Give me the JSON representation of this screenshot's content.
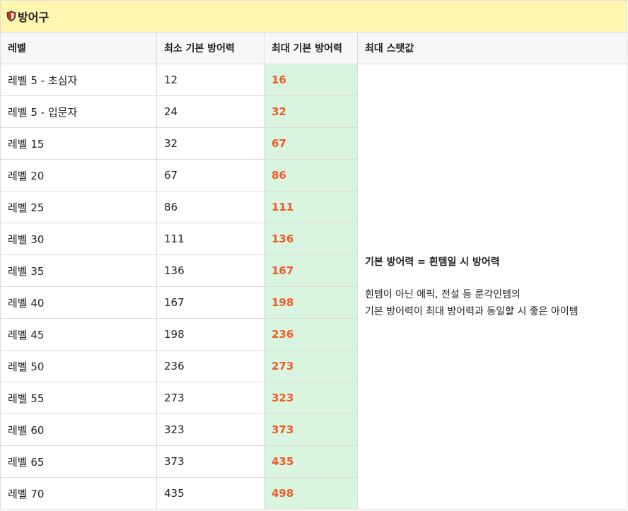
{
  "section": {
    "title": "방어구",
    "icon": "shield-icon",
    "colors": {
      "header_bg": "#fff7b0",
      "max_col_bg": "#d9f4df",
      "max_value": "#ef5a2a"
    }
  },
  "table": {
    "headers": [
      "레벨",
      "최소 기본 방어력",
      "최대 기본 방어력",
      "최대 스탯값"
    ],
    "rows": [
      {
        "level": "레벨 5 - 초심자",
        "min": "12",
        "max": "16"
      },
      {
        "level": "레벨 5 - 입문자",
        "min": "24",
        "max": "32"
      },
      {
        "level": "레벨 15",
        "min": "32",
        "max": "67"
      },
      {
        "level": "레벨 20",
        "min": "67",
        "max": "86"
      },
      {
        "level": "레벨 25",
        "min": "86",
        "max": "111"
      },
      {
        "level": "레벨 30",
        "min": "111",
        "max": "136"
      },
      {
        "level": "레벨 35",
        "min": "136",
        "max": "167"
      },
      {
        "level": "레벨 40",
        "min": "167",
        "max": "198"
      },
      {
        "level": "레벨 45",
        "min": "198",
        "max": "236"
      },
      {
        "level": "레벨 50",
        "min": "236",
        "max": "273"
      },
      {
        "level": "레벨 55",
        "min": "273",
        "max": "323"
      },
      {
        "level": "레벨 60",
        "min": "323",
        "max": "373"
      },
      {
        "level": "레벨 65",
        "min": "373",
        "max": "435"
      },
      {
        "level": "레벨 70",
        "min": "435",
        "max": "498"
      }
    ],
    "note": {
      "formula": "기본 방어력 = 흰템일 시 방어력",
      "line1": "흰템이 아닌 에픽, 전설 등 룬각인템의",
      "line2": "기본 방어력이 최대 방어력과 동일할 시 좋은 아이템"
    }
  }
}
